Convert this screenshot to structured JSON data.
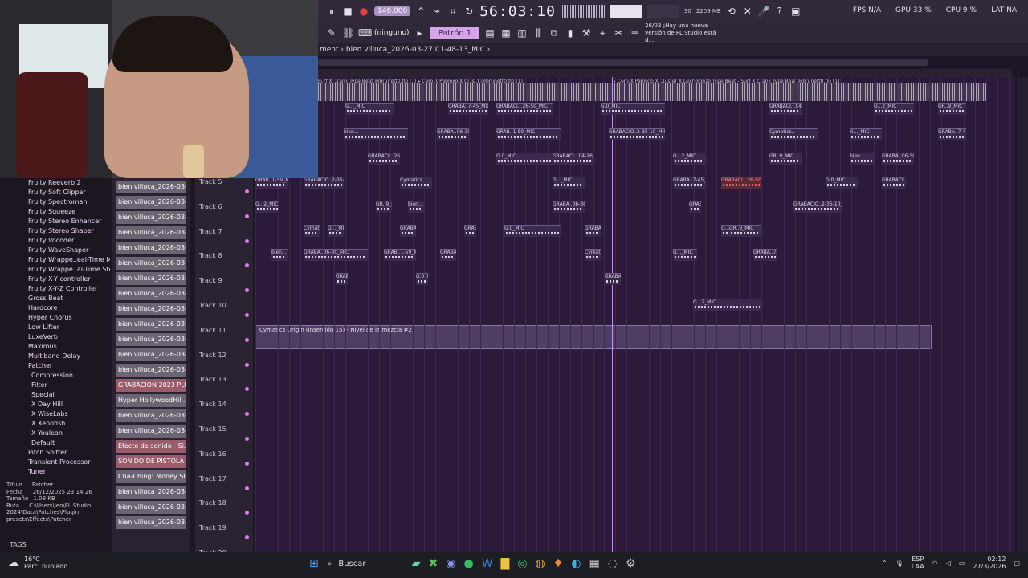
{
  "toolbar": {
    "tempo": "146.000",
    "time": "56:03:10",
    "memory_value": "30",
    "memory_mb": "2209 MB",
    "pattern_none": "(ninguno)",
    "pattern_label": "Patrón 1",
    "news_text": "26/03 ¡Hay una nueva versión de FL Studio está d...",
    "gpu": "GPU 33 %",
    "cpu": "CPU 9 %",
    "lang": "LAT NA",
    "fps": "FPS N/A"
  },
  "window": {
    "title_prefix": "ment",
    "title": "bien villuca_2026-03-27 01-48-13_MIC"
  },
  "browser": {
    "items": [
      {
        "label": "Fruity Reeverb 2",
        "kind": "plugin"
      },
      {
        "label": "Fruity Soft Clipper",
        "kind": "plugin"
      },
      {
        "label": "Fruity Spectroman",
        "kind": "plugin"
      },
      {
        "label": "Fruity Squeeze",
        "kind": "plugin"
      },
      {
        "label": "Fruity Stereo Enhancer",
        "kind": "plugin"
      },
      {
        "label": "Fruity Stereo Shaper",
        "kind": "plugin"
      },
      {
        "label": "Fruity Vocoder",
        "kind": "plugin"
      },
      {
        "label": "Fruity WaveShaper",
        "kind": "plugin"
      },
      {
        "label": "Fruity Wrappe..eal-Time Mono",
        "kind": "plugin"
      },
      {
        "label": "Fruity Wrappe..al-Time Stereo",
        "kind": "plugin"
      },
      {
        "label": "Fruity X-Y controller",
        "kind": "plugin"
      },
      {
        "label": "Fruity X-Y-Z Controller",
        "kind": "plugin"
      },
      {
        "label": "Gross Beat",
        "kind": "plugin"
      },
      {
        "label": "Hardcore",
        "kind": "plugin"
      },
      {
        "label": "Hyper Chorus",
        "kind": "plugin"
      },
      {
        "label": "Low Lifter",
        "kind": "plugin"
      },
      {
        "label": "LuxeVerb",
        "kind": "plugin"
      },
      {
        "label": "Maximus",
        "kind": "plugin"
      },
      {
        "label": "Multiband Delay",
        "kind": "plugin"
      },
      {
        "label": "Patcher",
        "kind": "group"
      },
      {
        "label": "Compression",
        "kind": "sub"
      },
      {
        "label": "Filter",
        "kind": "sub"
      },
      {
        "label": "Special",
        "kind": "sub"
      },
      {
        "label": "X Day Hill",
        "kind": "sub"
      },
      {
        "label": "X WiseLabs",
        "kind": "sub"
      },
      {
        "label": "X Xenofish",
        "kind": "sub"
      },
      {
        "label": "X Youlean",
        "kind": "sub"
      },
      {
        "label": "Default",
        "kind": "sub"
      },
      {
        "label": "Pitch Shifter",
        "kind": "plugin"
      },
      {
        "label": "Transient Processor",
        "kind": "plugin"
      },
      {
        "label": "Tuner",
        "kind": "plugin"
      }
    ],
    "meta": {
      "title_label": "Título",
      "title_value": "Patcher",
      "date_label": "Fecha",
      "date_value": "26/12/2025 23:14:26",
      "size_label": "Tamaño",
      "size_value": "1.08 KB",
      "path_label": "Ruta",
      "path_value": "C:\\Users\\leo\\FL Studio 2024\\Data\\Patches\\Plugin presets\\Effects\\Patcher"
    },
    "tags_label": "TAGS"
  },
  "channels": [
    {
      "label": "bien villuca_2026-03-27..."
    },
    {
      "label": "bien villuca_2026-03-27..."
    },
    {
      "label": "bien villuca_2026-03-27..."
    },
    {
      "label": "bien villuca_2026-03-27..."
    },
    {
      "label": "bien villuca_2026-03-27..."
    },
    {
      "label": "bien villuca_2026-03-27..."
    },
    {
      "label": "bien villuca_2026-03-27..."
    },
    {
      "label": "bien villuca_2026-03-27..."
    },
    {
      "label": "bien villuca_2026-03-27..."
    },
    {
      "label": "bien villuca_2026-03-27..."
    },
    {
      "label": "bien villuca_2026-03-27..."
    },
    {
      "label": "bien villuca_2026-03-27..."
    },
    {
      "label": "bien villuca_2026-03-27..."
    },
    {
      "label": "GRABACION 2023 PLU..."
    },
    {
      "label": "Hyper HollywoodHill..."
    },
    {
      "label": "bien villuca_2026-03-27..."
    },
    {
      "label": "bien villuca_2026-03-27..."
    },
    {
      "label": "Efecto de sonido - Si..."
    },
    {
      "label": "SONIDO DE PISTOLA"
    },
    {
      "label": "Cha-Ching! Money SO..."
    },
    {
      "label": "bien villuca_2026-03-27..."
    },
    {
      "label": "bien villuca_2026-03-27..."
    },
    {
      "label": "bien villuca_2026-03-27..."
    }
  ],
  "tracks": [
    "Track 5",
    "Track 6",
    "Track 7",
    "Track 8",
    "Track 9",
    "Track 10",
    "Track 11",
    "Track 12",
    "Track 13",
    "Track 14",
    "Track 15",
    "Track 16",
    "Track 17",
    "Track 18",
    "Track 19",
    "Track 20"
  ],
  "playlist": {
    "top_clip_a": "X Luxholonso Type Beat - Surf X Crank Type Beat @brunett0.flp (1) ▸ Cero X Pabloxo X Clus..t @brunett0.flp (1)",
    "top_clip_b": "▸ Cero X Pabloxo X Cluster X Luxholonso Type Beat - Surf X Crank Type Beat @brunett0.flp (1)",
    "clip_names": [
      "G..._MIC",
      "GRABA..7-45_MIC",
      "GRABACI...26-50_MIC",
      "G.0_MIC",
      "GRABACI...04-26_MIC",
      "G...2_MIC",
      "GR..9_MIC",
      "bien...",
      "GRABA..06-30_MIC",
      "GRAB..1-59_MIC",
      "GRABACIO..2-35-10_MIC",
      "Cymatics.."
    ],
    "automation_label": "Cymatics Origin (Inserción 15) - Nivel de la mezcla #2"
  },
  "taskbar": {
    "search_label": "Buscar",
    "weather_temp": "16°C",
    "weather_desc": "Parc. nublado",
    "lang1": "ESP",
    "lang2": "LAA",
    "time": "02:12",
    "date": "27/3/2026"
  }
}
